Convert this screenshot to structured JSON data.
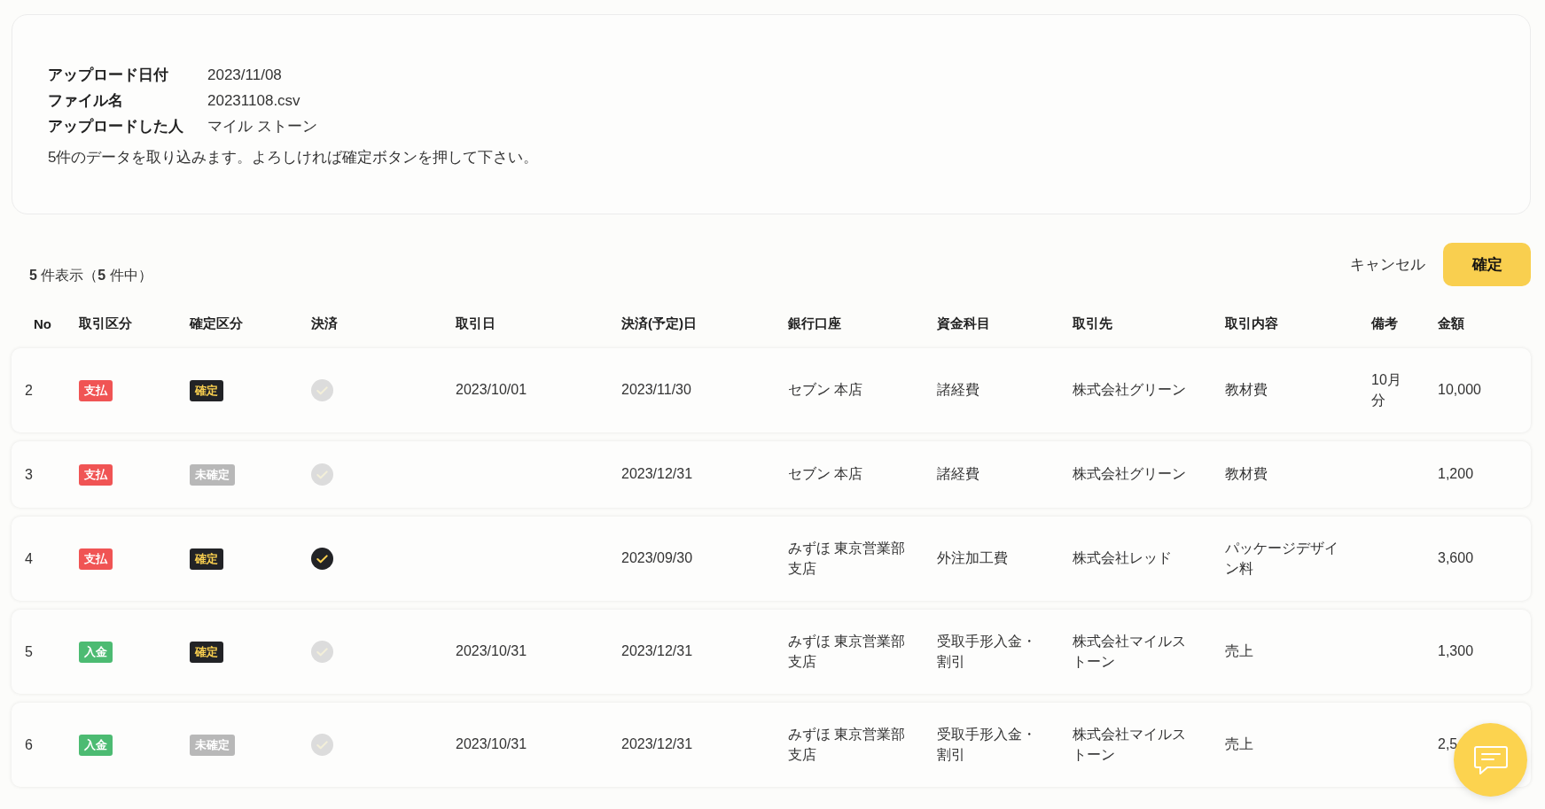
{
  "upload_info": {
    "fields": [
      {
        "label": "アップロード日付",
        "value": "2023/11/08"
      },
      {
        "label": "ファイル名",
        "value": "20231108.csv"
      },
      {
        "label": "アップロードした人",
        "value": "マイル ストーン"
      }
    ],
    "message": "5件のデータを取り込みます。よろしければ確定ボタンを押して下さい。"
  },
  "count": "**5** 件表示（**5** 件中）",
  "actions": {
    "cancel": "キャンセル",
    "confirm": "確定"
  },
  "table": {
    "columns": [
      "No",
      "取引区分",
      "確定区分",
      "決済",
      "取引日",
      "決済(予定)日",
      "銀行口座",
      "資金科目",
      "取引先",
      "取引内容",
      "備考",
      "金額"
    ],
    "rows": [
      {
        "no": "2",
        "type": {
          "label": "支払",
          "kind": "payment"
        },
        "status": {
          "label": "確定",
          "confirmed": true
        },
        "settled": false,
        "date": "2023/10/01",
        "due_date": "2023/11/30",
        "bank": "セブン 本店",
        "category": "諸経費",
        "partner": "株式会社グリーン",
        "content": "教材費",
        "note": "10月分",
        "amount": "10,000"
      },
      {
        "no": "3",
        "type": {
          "label": "支払",
          "kind": "payment"
        },
        "status": {
          "label": "未確定",
          "confirmed": false
        },
        "settled": false,
        "date": "",
        "due_date": "2023/12/31",
        "bank": "セブン 本店",
        "category": "諸経費",
        "partner": "株式会社グリーン",
        "content": "教材費",
        "note": "",
        "amount": "1,200"
      },
      {
        "no": "4",
        "type": {
          "label": "支払",
          "kind": "payment"
        },
        "status": {
          "label": "確定",
          "confirmed": true
        },
        "settled": true,
        "date": "",
        "due_date": "2023/09/30",
        "bank": "みずほ 東京営業部支店",
        "category": "外注加工費",
        "partner": "株式会社レッド",
        "content": "パッケージデザイン料",
        "note": "",
        "amount": "3,600"
      },
      {
        "no": "5",
        "type": {
          "label": "入金",
          "kind": "deposit"
        },
        "status": {
          "label": "確定",
          "confirmed": true
        },
        "settled": false,
        "date": "2023/10/31",
        "due_date": "2023/12/31",
        "bank": "みずほ 東京営業部支店",
        "category": "受取手形入金・割引",
        "partner": "株式会社マイルストーン",
        "content": "売上",
        "note": "",
        "amount": "1,300"
      },
      {
        "no": "6",
        "type": {
          "label": "入金",
          "kind": "deposit"
        },
        "status": {
          "label": "未確定",
          "confirmed": false
        },
        "settled": false,
        "date": "2023/10/31",
        "due_date": "2023/12/31",
        "bank": "みずほ 東京営業部支店",
        "category": "受取手形入金・割引",
        "partner": "株式会社マイルストーン",
        "content": "売上",
        "note": "",
        "amount": "2,5"
      }
    ]
  }
}
